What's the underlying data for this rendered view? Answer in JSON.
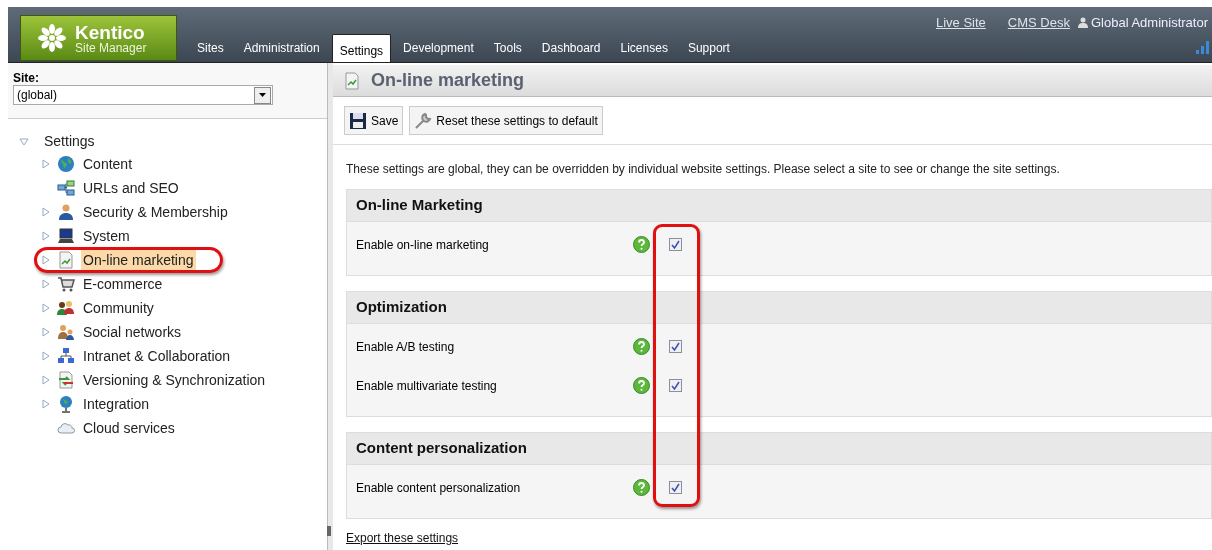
{
  "header": {
    "logo": {
      "title": "Kentico",
      "subtitle": "Site Manager"
    },
    "tabs": [
      {
        "label": "Sites",
        "selected": false
      },
      {
        "label": "Administration",
        "selected": false
      },
      {
        "label": "Settings",
        "selected": true
      },
      {
        "label": "Development",
        "selected": false
      },
      {
        "label": "Tools",
        "selected": false
      },
      {
        "label": "Dashboard",
        "selected": false
      },
      {
        "label": "Licenses",
        "selected": false
      },
      {
        "label": "Support",
        "selected": false
      }
    ],
    "links": [
      "Live Site",
      "CMS Desk"
    ],
    "user": "Global Administrator"
  },
  "sidebar": {
    "site_label": "Site:",
    "site_value": "(global)",
    "tree": [
      {
        "label": "Settings",
        "expanded": true,
        "children": [
          {
            "label": "Content",
            "expandable": true,
            "selected": false
          },
          {
            "label": "URLs and SEO",
            "expandable": false,
            "selected": false
          },
          {
            "label": "Security & Membership",
            "expandable": true,
            "selected": false
          },
          {
            "label": "System",
            "expandable": true,
            "selected": false
          },
          {
            "label": "On-line marketing",
            "expandable": true,
            "selected": true
          },
          {
            "label": "E-commerce",
            "expandable": true,
            "selected": false
          },
          {
            "label": "Community",
            "expandable": true,
            "selected": false
          },
          {
            "label": "Social networks",
            "expandable": true,
            "selected": false
          },
          {
            "label": "Intranet & Collaboration",
            "expandable": true,
            "selected": false
          },
          {
            "label": "Versioning & Synchronization",
            "expandable": true,
            "selected": false
          },
          {
            "label": "Integration",
            "expandable": true,
            "selected": false
          },
          {
            "label": "Cloud services",
            "expandable": false,
            "selected": false
          }
        ]
      }
    ]
  },
  "main": {
    "title": "On-line marketing",
    "toolbar": [
      "Save",
      "Reset these settings to default"
    ],
    "description": "These settings are global, they can be overridden by individual website settings. Please select a site to see or change the site settings.",
    "sections": [
      {
        "title": "On-line Marketing",
        "settings": [
          {
            "label": "Enable on-line marketing",
            "checked": true
          }
        ]
      },
      {
        "title": "Optimization",
        "settings": [
          {
            "label": "Enable A/B testing",
            "checked": true
          },
          {
            "label": "Enable multivariate testing",
            "checked": true
          }
        ]
      },
      {
        "title": "Content personalization",
        "settings": [
          {
            "label": "Enable content personalization",
            "checked": true
          }
        ]
      }
    ],
    "export_link": "Export these settings"
  }
}
